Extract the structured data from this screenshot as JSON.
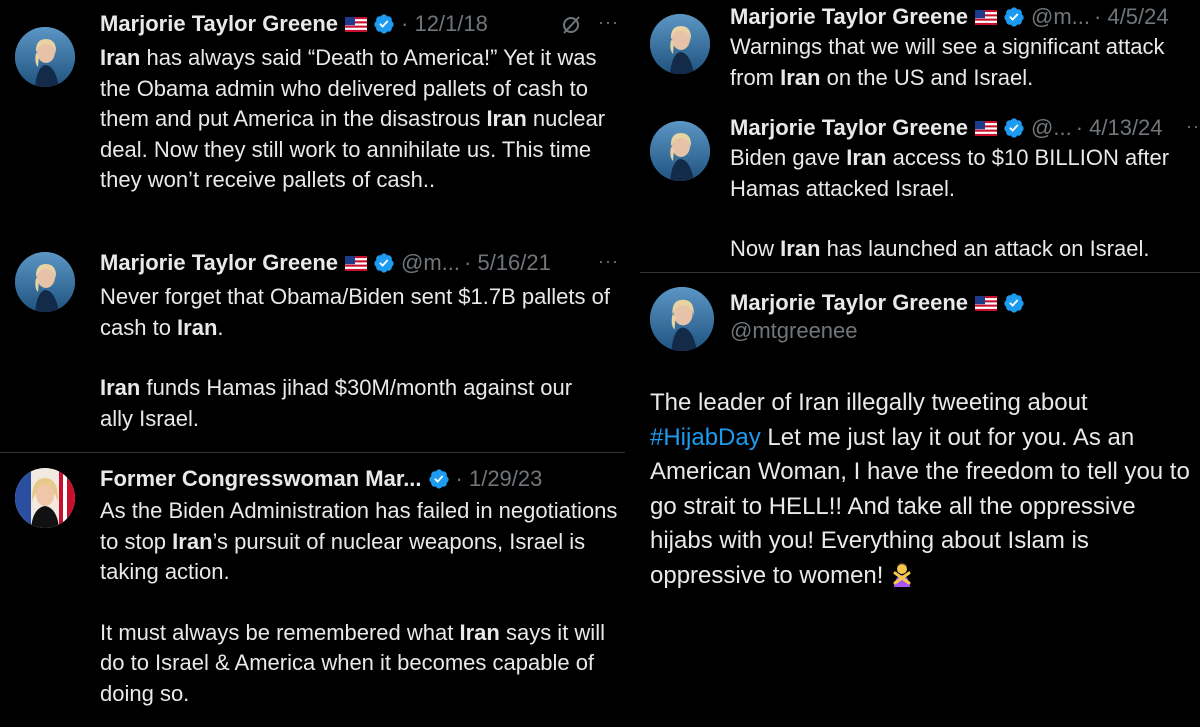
{
  "tweets_left": [
    {
      "name": "Marjorie Taylor Greene",
      "handle": "",
      "date": "· 12/1/18",
      "text_parts": [
        [
          {
            "t": "Iran",
            "b": true
          },
          {
            "t": " has always said “Death to America!” Yet it was the Obama admin who delivered pallets of cash to them and put America in the disastrous "
          },
          {
            "t": "Iran",
            "b": true
          },
          {
            "t": " nuclear deal. Now they still work to annihilate us. This time they won’t receive pallets of cash.."
          }
        ]
      ]
    },
    {
      "name": "Marjorie Taylor Greene",
      "handle": "@m...",
      "date": "· 5/16/21",
      "text_parts": [
        [
          {
            "t": "Never forget that Obama/Biden sent $1.7B pallets of cash to "
          },
          {
            "t": "Iran",
            "b": true
          },
          {
            "t": "."
          }
        ],
        [
          {
            "t": "Iran",
            "b": true
          },
          {
            "t": " funds Hamas jihad $30M/month against our ally Israel."
          }
        ]
      ]
    },
    {
      "name": "Former Congresswoman Mar...",
      "handle": "",
      "date": "· 1/29/23",
      "text_parts": [
        [
          {
            "t": "As the Biden Administration has failed in negotiations to stop "
          },
          {
            "t": "Iran",
            "b": true
          },
          {
            "t": "’s pursuit of nuclear weapons, Israel is taking action."
          }
        ],
        [
          {
            "t": "It must always be remembered what "
          },
          {
            "t": "Iran",
            "b": true
          },
          {
            "t": " says it will do to Israel & America when it becomes capable of doing so."
          }
        ]
      ]
    }
  ],
  "tweets_right": [
    {
      "name": "Marjorie Taylor Greene",
      "handle": "@m...",
      "date": "· 4/5/24",
      "text_parts": [
        [
          {
            "t": "Warnings that we will see a significant attack from "
          },
          {
            "t": "Iran",
            "b": true
          },
          {
            "t": " on the US and Israel."
          }
        ]
      ]
    },
    {
      "name": "Marjorie Taylor Greene",
      "handle": "@...",
      "date": "· 4/13/24",
      "text_parts": [
        [
          {
            "t": "Biden gave "
          },
          {
            "t": "Iran",
            "b": true
          },
          {
            "t": " access to $10 BILLION after Hamas attacked Israel."
          }
        ],
        [
          {
            "t": "Now "
          },
          {
            "t": "Iran",
            "b": true
          },
          {
            "t": " has launched an attack on Israel."
          }
        ]
      ]
    }
  ],
  "main_tweet": {
    "name": "Marjorie Taylor Greene",
    "handle": "@mtgreenee",
    "text_parts": [
      {
        "t": "The leader of Iran illegally tweeting about "
      },
      {
        "t": "#HijabDay",
        "hashtag": true
      },
      {
        "t": " Let me just lay it out for you. As an American Woman, I have the freedom to tell you to go strait to HELL!! And take all the oppressive hijabs with you! Everything about Islam is oppressive to women!"
      }
    ],
    "emoji": "person-gesturing-no-emoji"
  },
  "icons": {
    "flag": "us-flag-icon",
    "verified": "verified-badge-icon",
    "more": "more-dots-icon",
    "grok": "grok-icon"
  },
  "colors": {
    "background": "#000000",
    "text": "#e7e9ea",
    "muted": "#71767b",
    "link": "#1d9bf0",
    "verified": "#1d9bf0",
    "separator": "#2f3336"
  }
}
